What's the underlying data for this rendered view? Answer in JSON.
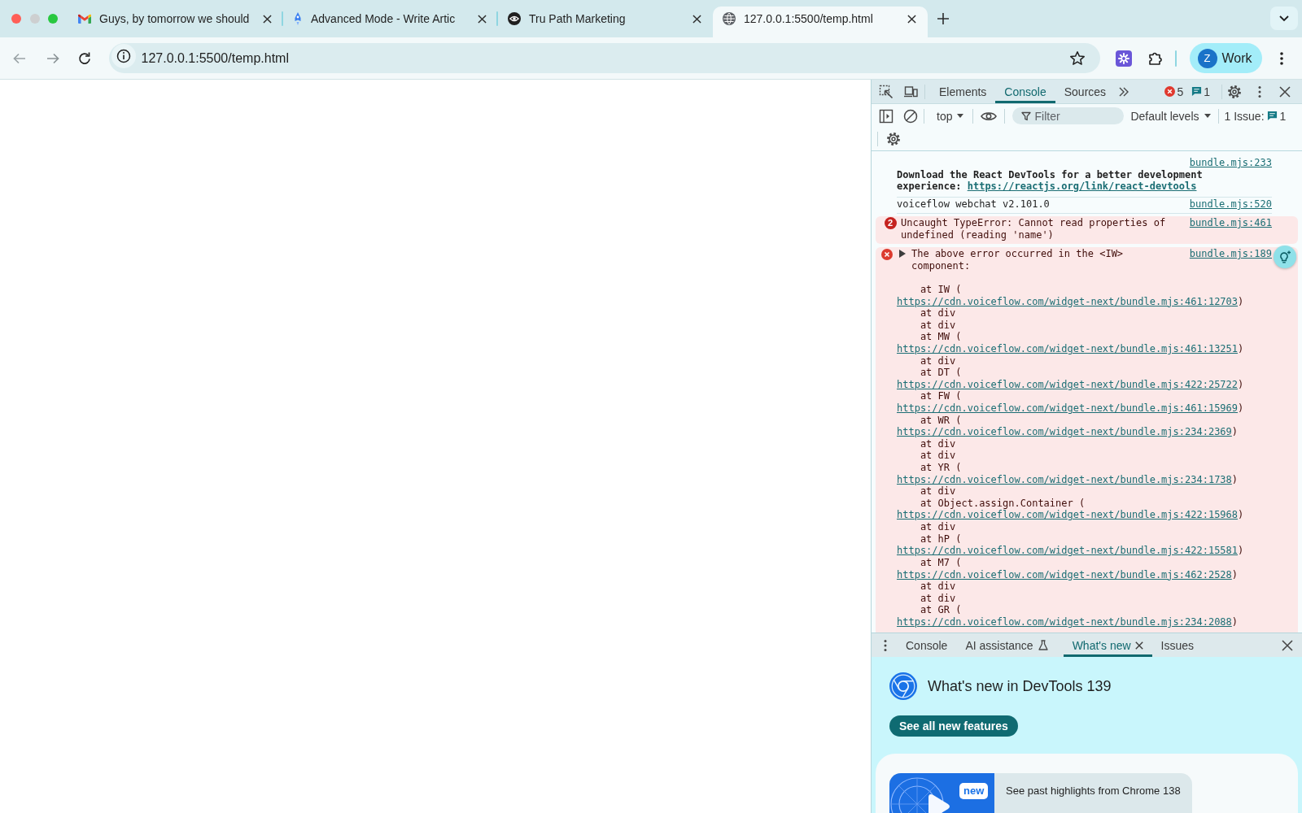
{
  "window": {
    "traffic_lights": [
      {
        "color": "#ff5f57"
      },
      {
        "color": "#cdcfd0"
      },
      {
        "color": "#28c840"
      }
    ]
  },
  "tabs": [
    {
      "title": "Guys, by tomorrow we should",
      "kind": "mail",
      "selected": false
    },
    {
      "title": "Advanced Mode - Write Artic",
      "kind": "rocket",
      "selected": false
    },
    {
      "title": "Tru Path Marketing",
      "kind": "eye",
      "selected": false
    },
    {
      "title": "127.0.0.1:5500/temp.html",
      "kind": "globe",
      "selected": true
    }
  ],
  "toolbar": {
    "url": "127.0.0.1:5500/temp.html",
    "profile": {
      "initial": "Z",
      "name": "Work"
    }
  },
  "devtools": {
    "panel_tabs": [
      {
        "label": "Elements",
        "selected": false
      },
      {
        "label": "Console",
        "selected": true
      },
      {
        "label": "Sources",
        "selected": false
      }
    ],
    "error_count": "5",
    "message_count": "1",
    "console_toolbar": {
      "context": "top",
      "filter": {
        "placeholder": "Filter"
      },
      "levels": "Default levels",
      "issues_label": "1 Issue:",
      "issues_count": "1"
    },
    "messages": [
      {
        "kind": "info",
        "source": "bundle.mjs:233",
        "text": "Download the React DevTools for a better development experience:",
        "link": "https://reactjs.org/link/react-devtools"
      },
      {
        "kind": "log",
        "source": "bundle.mjs:520",
        "text": "voiceflow webchat v2.101.0"
      },
      {
        "kind": "error",
        "repeat": "2",
        "source": "bundle.mjs:461",
        "text": "Uncaught TypeError: Cannot read properties of undefined (reading 'name')"
      },
      {
        "kind": "trace",
        "expanded": false,
        "source": "bundle.mjs:189",
        "text": "The above error occurred in the <IW> component:",
        "frames": [
          {
            "call": "at IW (",
            "link": "https://cdn.voiceflow.com/widget-next/bundle.mjs:461:12703",
            "suffix": ")"
          },
          {
            "call": "at div"
          },
          {
            "call": "at div"
          },
          {
            "call": "at MW (",
            "link": "https://cdn.voiceflow.com/widget-next/bundle.mjs:461:13251",
            "suffix": ")"
          },
          {
            "call": "at div"
          },
          {
            "call": "at DT (",
            "link": "https://cdn.voiceflow.com/widget-next/bundle.mjs:422:25722",
            "suffix": ")"
          },
          {
            "call": "at FW (",
            "link": "https://cdn.voiceflow.com/widget-next/bundle.mjs:461:15969",
            "suffix": ")"
          },
          {
            "call": "at WR (",
            "link": "https://cdn.voiceflow.com/widget-next/bundle.mjs:234:2369",
            "suffix": ")"
          },
          {
            "call": "at div"
          },
          {
            "call": "at div"
          },
          {
            "call": "at YR (",
            "link": "https://cdn.voiceflow.com/widget-next/bundle.mjs:234:1738",
            "suffix": ")"
          },
          {
            "call": "at div"
          },
          {
            "call": "at Object.assign.Container (",
            "link": "https://cdn.voiceflow.com/widget-next/bundle.mjs:422:15968",
            "suffix": ")"
          },
          {
            "call": "at div"
          },
          {
            "call": "at hP (",
            "link": "https://cdn.voiceflow.com/widget-next/bundle.mjs:422:15581",
            "suffix": ")"
          },
          {
            "call": "at M7 (",
            "link": "https://cdn.voiceflow.com/widget-next/bundle.mjs:462:2528",
            "suffix": ")"
          },
          {
            "call": "at div"
          },
          {
            "call": "at div"
          },
          {
            "call": "at GR (",
            "link": "https://cdn.voiceflow.com/widget-next/bundle.mjs:234:2088",
            "suffix": ")"
          }
        ]
      }
    ],
    "drawer": {
      "tabs": [
        {
          "label": "Console",
          "selected": false,
          "experimental": false,
          "closable": false
        },
        {
          "label": "AI assistance",
          "selected": false,
          "experimental": true,
          "closable": false
        },
        {
          "label": "What's new",
          "selected": true,
          "experimental": false,
          "closable": true
        },
        {
          "label": "Issues",
          "selected": false,
          "experimental": false,
          "closable": false
        }
      ],
      "whats_new": {
        "title": "What's new in DevTools 139",
        "button": "See all new features",
        "highlight": {
          "badge": "new",
          "text": "See past highlights from Chrome 138"
        }
      }
    }
  }
}
